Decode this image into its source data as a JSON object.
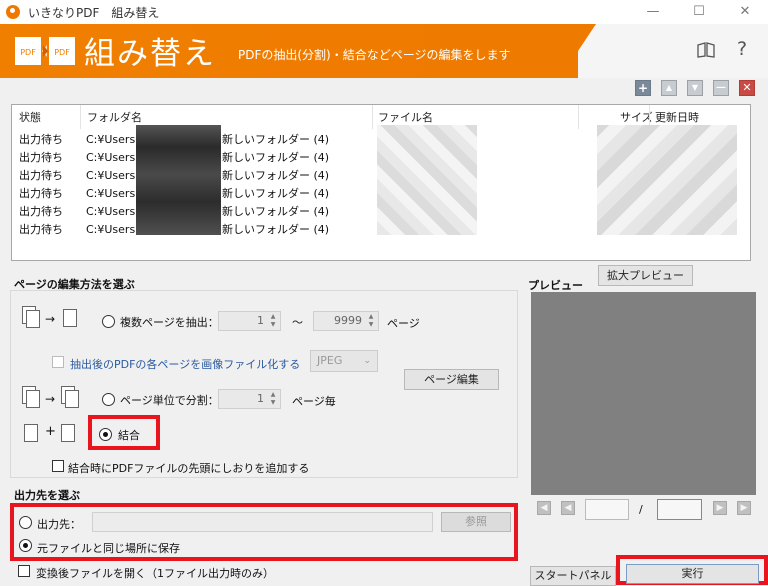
{
  "window": {
    "title": "いきなりPDF　組み替え",
    "min_icon": "minimize-icon",
    "max_icon": "maximize-icon",
    "close_icon": "close-icon"
  },
  "header": {
    "title": "組み替え",
    "description": "PDFの抽出(分割)・結合などページの編集をします",
    "logo_left": "PDF",
    "logo_right": "PDF",
    "manual_icon": "book-icon",
    "help_label": "?"
  },
  "list_toolbar": {
    "add": "+",
    "up": "▲",
    "down": "▼",
    "remove": "―",
    "clear": "✕"
  },
  "file_list": {
    "columns": [
      "状態",
      "フォルダ名",
      "ファイル名",
      "サイズ",
      "更新日時"
    ],
    "rows": [
      {
        "status": "出力待ち",
        "folder": "C:¥Users",
        "folder_tail": "新しいフォルダー (4)"
      },
      {
        "status": "出力待ち",
        "folder": "C:¥Users",
        "folder_tail": "新しいフォルダー (4)"
      },
      {
        "status": "出力待ち",
        "folder": "C:¥Users",
        "folder_tail": "新しいフォルダー (4)"
      },
      {
        "status": "出力待ち",
        "folder": "C:¥Users",
        "folder_tail": "新しいフォルダー (4)"
      },
      {
        "status": "出力待ち",
        "folder": "C:¥Users",
        "folder_tail": "新しいフォルダー (4)"
      },
      {
        "status": "出力待ち",
        "folder": "C:¥Users",
        "folder_tail": "新しいフォルダー (4)"
      }
    ]
  },
  "edit": {
    "section_title": "ページの編集方法を選ぶ",
    "extract_label": "複数ページを抽出：",
    "extract_from": "1",
    "range_sep": "～",
    "extract_to": "9999",
    "page_unit": "ページ",
    "to_image_label": "抽出後のPDFの各ページを画像ファイル化する",
    "image_format": "JPEG",
    "page_edit_button": "ページ編集",
    "split_label": "ページ単位で分割：",
    "split_value": "1",
    "split_unit": "ページ毎",
    "merge_label": "結合",
    "bookmark_label": "結合時にPDFファイルの先頭にしおりを追加する",
    "arrow": "→",
    "plus": "+"
  },
  "output": {
    "section_title": "出力先を選ぶ",
    "dest_label": "出力先：",
    "browse_button": "参照",
    "same_place_label": "元ファイルと同じ場所に保存",
    "open_after_label": "変換後ファイルを開く（1ファイル出力時のみ）"
  },
  "preview": {
    "title": "プレビュー",
    "zoom_button": "拡大プレビュー",
    "page_sep": "/"
  },
  "footer": {
    "start_panel_button": "スタートパネル",
    "run_button": "実行"
  },
  "colors": {
    "accent": "#f07f00",
    "highlight": "#e8141e"
  }
}
